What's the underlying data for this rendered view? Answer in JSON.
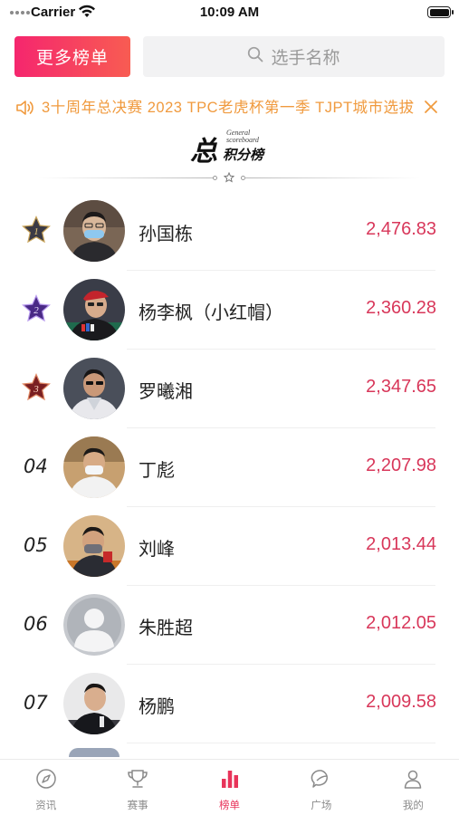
{
  "status_bar": {
    "carrier": "Carrier",
    "time": "10:09 AM"
  },
  "header": {
    "more_label": "更多榜单",
    "search_placeholder": "选手名称"
  },
  "marquee": {
    "text": "3十周年总决赛 2023 TPC老虎杯第一季 TJPT城市选拔"
  },
  "title_logo": {
    "main": "总",
    "sub": "积分榜",
    "en_line1": "General",
    "en_line2": "scoreboard"
  },
  "colors": {
    "accent": "#e8345a",
    "score": "#d8375a",
    "marquee": "#f09a3e",
    "button_start": "#f5266e",
    "button_end": "#f85c52"
  },
  "ranking": [
    {
      "rank": "1",
      "name": "孙国栋",
      "score": "2,476.83",
      "badge": "rank-1-star-badge"
    },
    {
      "rank": "2",
      "name": "杨李枫（小红帽）",
      "score": "2,360.28",
      "badge": "rank-2-star-badge"
    },
    {
      "rank": "3",
      "name": "罗曦湘",
      "score": "2,347.65",
      "badge": "rank-3-star-badge"
    },
    {
      "rank": "04",
      "name": "丁彪",
      "score": "2,207.98"
    },
    {
      "rank": "05",
      "name": "刘峰",
      "score": "2,013.44"
    },
    {
      "rank": "06",
      "name": "朱胜超",
      "score": "2,012.05"
    },
    {
      "rank": "07",
      "name": "杨鹏",
      "score": "2,009.58"
    }
  ],
  "tabs": [
    {
      "label": "资讯",
      "icon": "compass-icon",
      "active": false
    },
    {
      "label": "赛事",
      "icon": "trophy-icon",
      "active": false
    },
    {
      "label": "榜单",
      "icon": "bar-chart-icon",
      "active": true
    },
    {
      "label": "广场",
      "icon": "chat-bubble-icon",
      "active": false
    },
    {
      "label": "我的",
      "icon": "user-icon",
      "active": false
    }
  ]
}
